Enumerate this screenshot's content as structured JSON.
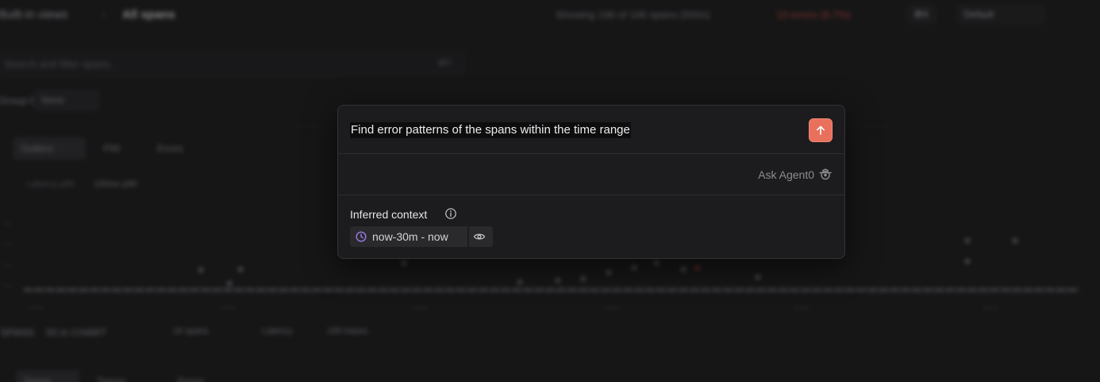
{
  "background": {
    "breadcrumb": [
      "Built-in views",
      "All spans"
    ],
    "header_status": "Showing 196 of 196 spans (50/m)",
    "header_error": "13 errors (6.7%)",
    "header_buttons": [
      "⌘K",
      "Default"
    ],
    "search_placeholder": "Search and filter spans...",
    "search_shortcut": "⌘F",
    "group_by_label": "Group by",
    "group_by_value": "None",
    "chart_tabs": [
      "Outliers",
      "P50",
      "Errors"
    ],
    "summary_labels": [
      "Latency p95",
      "100ms p99"
    ],
    "footer_items": [
      "SPANS",
      "50 in CHART",
      "16 spans",
      "Latency",
      "195 traces"
    ],
    "bottom_tabs": [
      "Spans",
      "Traces",
      "Errors"
    ]
  },
  "modal": {
    "prompt_text": "Find error patterns of the spans within the time range",
    "send_icon": "arrow-up-icon",
    "agent_label": "Ask Agent0",
    "agent_icon": "agent0-icon",
    "context_title": "Inferred context",
    "context_chip_text": "now-30m - now",
    "colors": {
      "accent": "#e8705c",
      "clock": "#9b7be0"
    }
  }
}
